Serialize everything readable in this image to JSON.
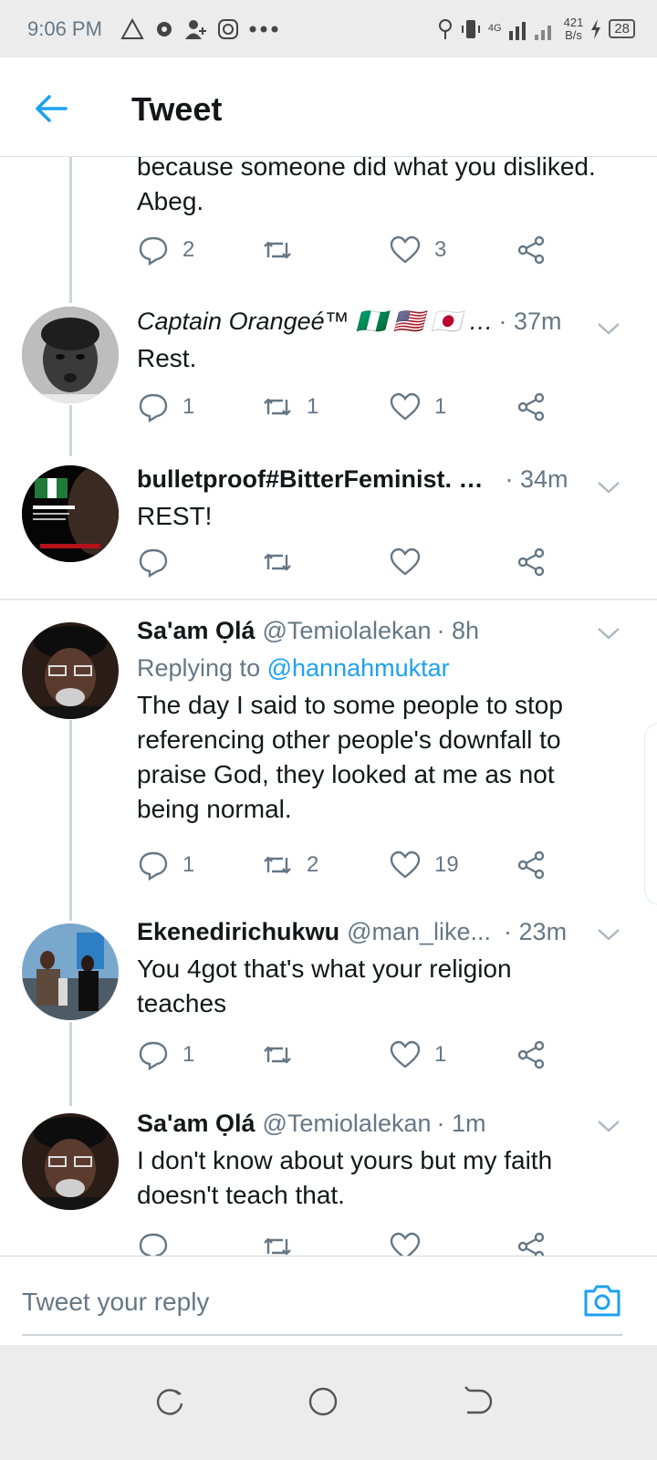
{
  "status_bar": {
    "time": "9:06 PM",
    "network_label": "4G",
    "net_speed_value": "421",
    "net_speed_unit": "B/s",
    "battery": "28"
  },
  "header": {
    "title": "Tweet"
  },
  "tweets": [
    {
      "text": "because someone did what you disliked. Abeg.",
      "replies": "2",
      "retweets": "",
      "likes": "3"
    },
    {
      "name": "Captain Orangeé™ 🇳🇬 🇺🇸 🇯🇵 …",
      "time": "· 37m",
      "text": "Rest.",
      "replies": "1",
      "retweets": "1",
      "likes": "1"
    },
    {
      "name": "bulletproof#BitterFeminist. …",
      "time": "· 34m",
      "text": "REST!",
      "replies": "",
      "retweets": "",
      "likes": ""
    },
    {
      "name": "Sa'am Ọlá",
      "handle": "@Temiolalekan",
      "time": "· 8h",
      "reply_prefix": "Replying to",
      "reply_mention": "@hannahmuktar",
      "text": "The day I said to some people to stop referencing other people's downfall to praise God, they looked at me as not being normal.",
      "replies": "1",
      "retweets": "2",
      "likes": "19"
    },
    {
      "name": "Ekenedirichukwu",
      "handle": "@man_like...",
      "time": "· 23m",
      "text": "You 4got that's what your religion teaches",
      "replies": "1",
      "retweets": "",
      "likes": "1"
    },
    {
      "name": "Sa'am Ọlá",
      "handle": "@Temiolalekan",
      "time": "· 1m",
      "text": "I don't know about yours but my faith doesn't teach that.",
      "replies": "",
      "retweets": "",
      "likes": ""
    }
  ],
  "reply_bar": {
    "placeholder": "Tweet your reply"
  },
  "icons": {
    "accent": "#1da1f2",
    "secondary_text": "#657786"
  }
}
